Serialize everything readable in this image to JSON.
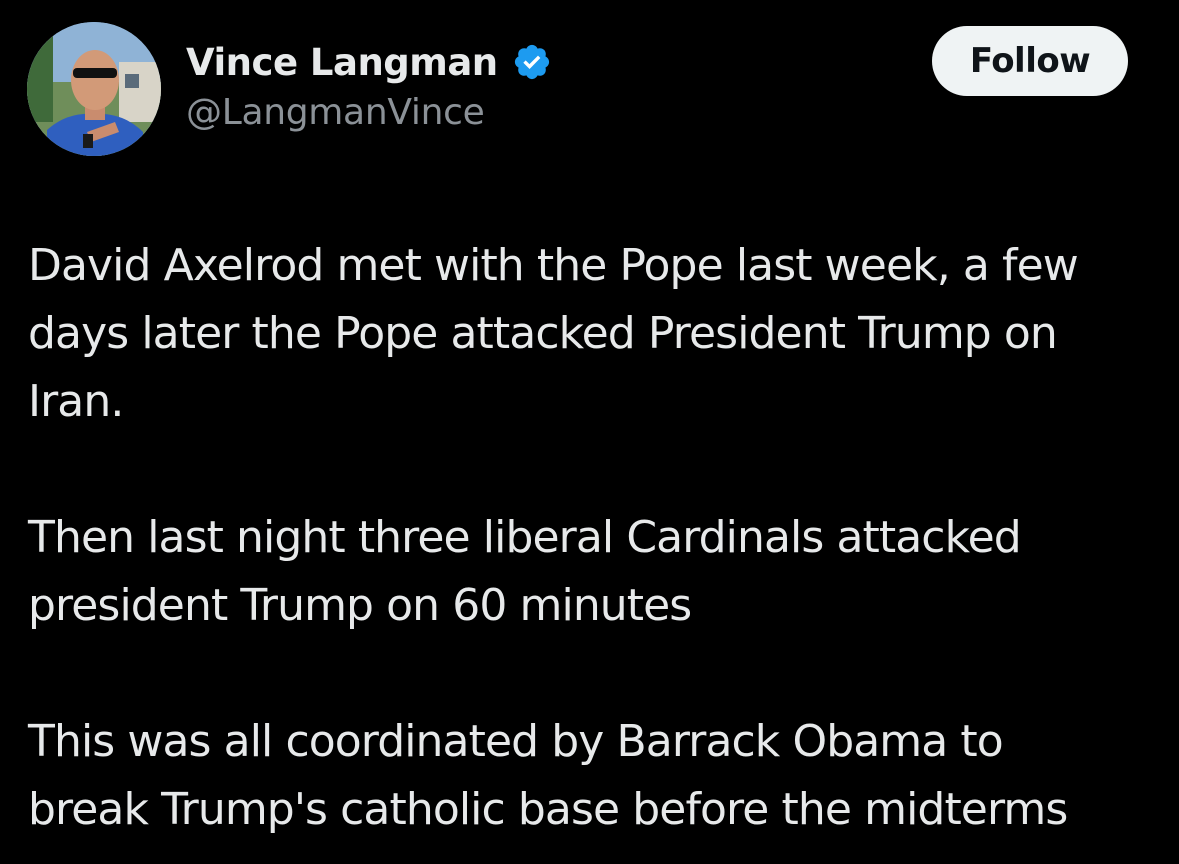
{
  "author": {
    "display_name": "Vince Langman",
    "handle": "@LangmanVince",
    "verified_icon": "verified-badge-icon",
    "badge_color": "#1d9bf0"
  },
  "actions": {
    "follow_label": "Follow"
  },
  "tweet": {
    "paragraphs": [
      {
        "lines": [
          "David Axelrod met with the Pope last week, a few",
          "days later the Pope attacked President Trump on",
          "Iran."
        ]
      },
      {
        "lines": [
          "Then last night three liberal Cardinals attacked",
          "president Trump on 60 minutes"
        ]
      },
      {
        "lines": [
          "This was all coordinated by Barrack Obama to",
          "break Trump's catholic base before the midterms"
        ]
      }
    ]
  },
  "colors": {
    "background": "#000000",
    "text": "#e7e9ea",
    "secondary_text": "#8b9197",
    "button_bg": "#eff3f4",
    "button_text": "#0f1419"
  }
}
